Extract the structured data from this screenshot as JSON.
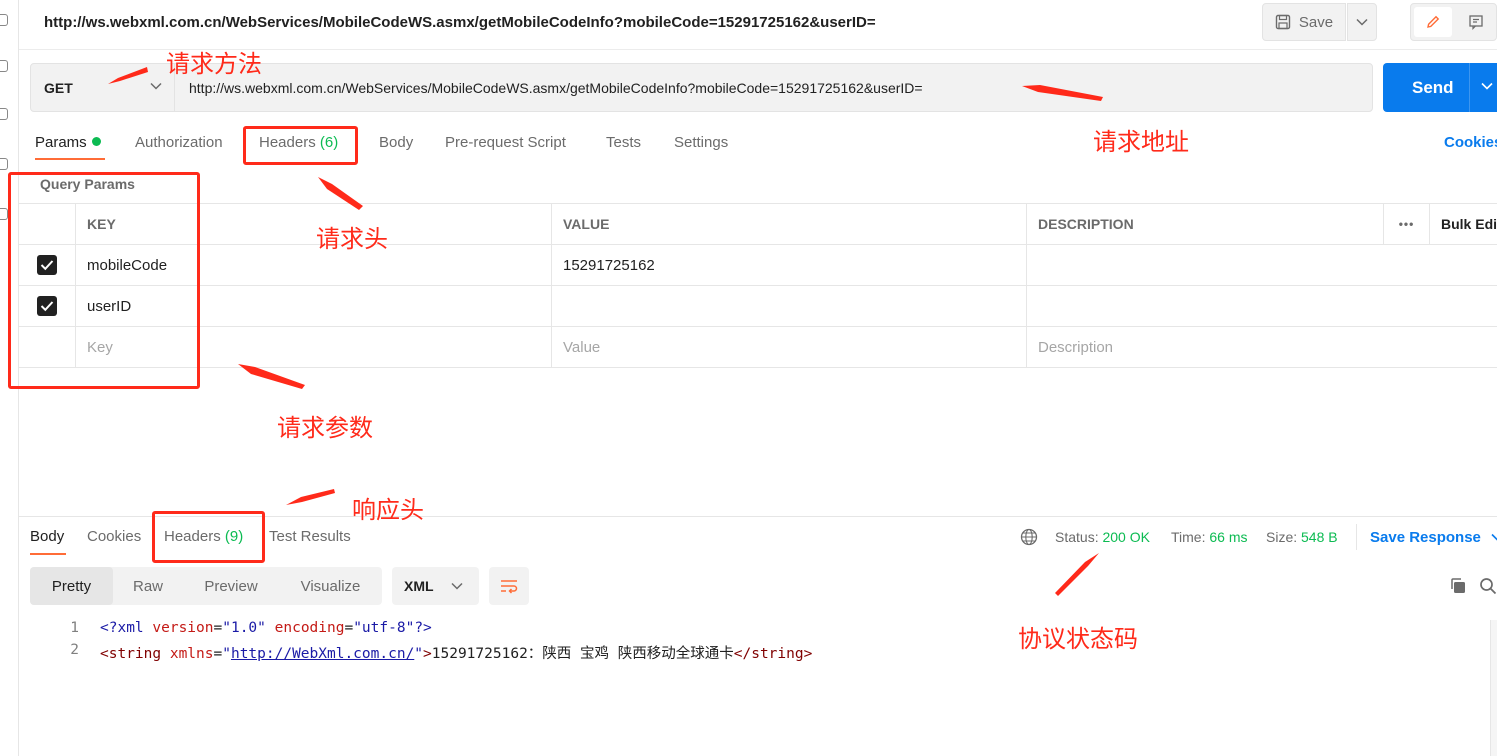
{
  "request": {
    "title": "http://ws.webxml.com.cn/WebServices/MobileCodeWS.asmx/getMobileCodeInfo?mobileCode=15291725162&userID=",
    "method": "GET",
    "url": "http://ws.webxml.com.cn/WebServices/MobileCodeWS.asmx/getMobileCodeInfo?mobileCode=15291725162&userID=",
    "save_label": "Save",
    "send_label": "Send"
  },
  "request_tabs": {
    "params": "Params",
    "authorization": "Authorization",
    "headers": "Headers",
    "headers_count": "(6)",
    "body": "Body",
    "prerequest": "Pre-request Script",
    "tests": "Tests",
    "settings": "Settings",
    "cookies": "Cookies"
  },
  "query_params": {
    "title": "Query Params",
    "columns": {
      "key": "KEY",
      "value": "VALUE",
      "description": "DESCRIPTION",
      "more": "•••",
      "bulk_edit": "Bulk Edit"
    },
    "rows": [
      {
        "key": "mobileCode",
        "value": "15291725162",
        "description": "",
        "checked": true
      },
      {
        "key": "userID",
        "value": "",
        "description": "",
        "checked": true
      }
    ],
    "placeholder": {
      "key": "Key",
      "value": "Value",
      "description": "Description"
    }
  },
  "response_tabs": {
    "body": "Body",
    "cookies": "Cookies",
    "headers": "Headers",
    "headers_count": "(9)",
    "test_results": "Test Results"
  },
  "status": {
    "status_label": "Status:",
    "status_value": "200 OK",
    "time_label": "Time:",
    "time_value": "66 ms",
    "size_label": "Size:",
    "size_value": "548 B",
    "save_response": "Save Response"
  },
  "format": {
    "pretty": "Pretty",
    "raw": "Raw",
    "preview": "Preview",
    "visualize": "Visualize",
    "language": "XML"
  },
  "code": {
    "line1_num": "1",
    "line2_num": "2",
    "l1_open": "<?xml",
    "l1_attr1": "version",
    "l1_eq1": "=",
    "l1_val1": "\"1.0\"",
    "l1_attr2": "encoding",
    "l1_eq2": "=",
    "l1_val2": "\"utf-8\"",
    "l1_close": "?>",
    "l2_open": "<string",
    "l2_attr": "xmlns",
    "l2_eq": "=",
    "l2_q1": "\"",
    "l2_link": "http://WebXml.com.cn/",
    "l2_q2": "\"",
    "l2_gt": ">",
    "l2_text": "15291725162：陕西 宝鸡 陕西移动全球通卡",
    "l2_end": "</string>"
  },
  "annotations": {
    "method": "请求方法",
    "url": "请求地址",
    "req_headers": "请求头",
    "params": "请求参数",
    "resp_headers": "响应头",
    "status": "协议状态码"
  },
  "colors": {
    "accent": "#ff6c37",
    "primary": "#097bed",
    "success": "#0cbb52",
    "annotation": "#ff2a1a"
  }
}
